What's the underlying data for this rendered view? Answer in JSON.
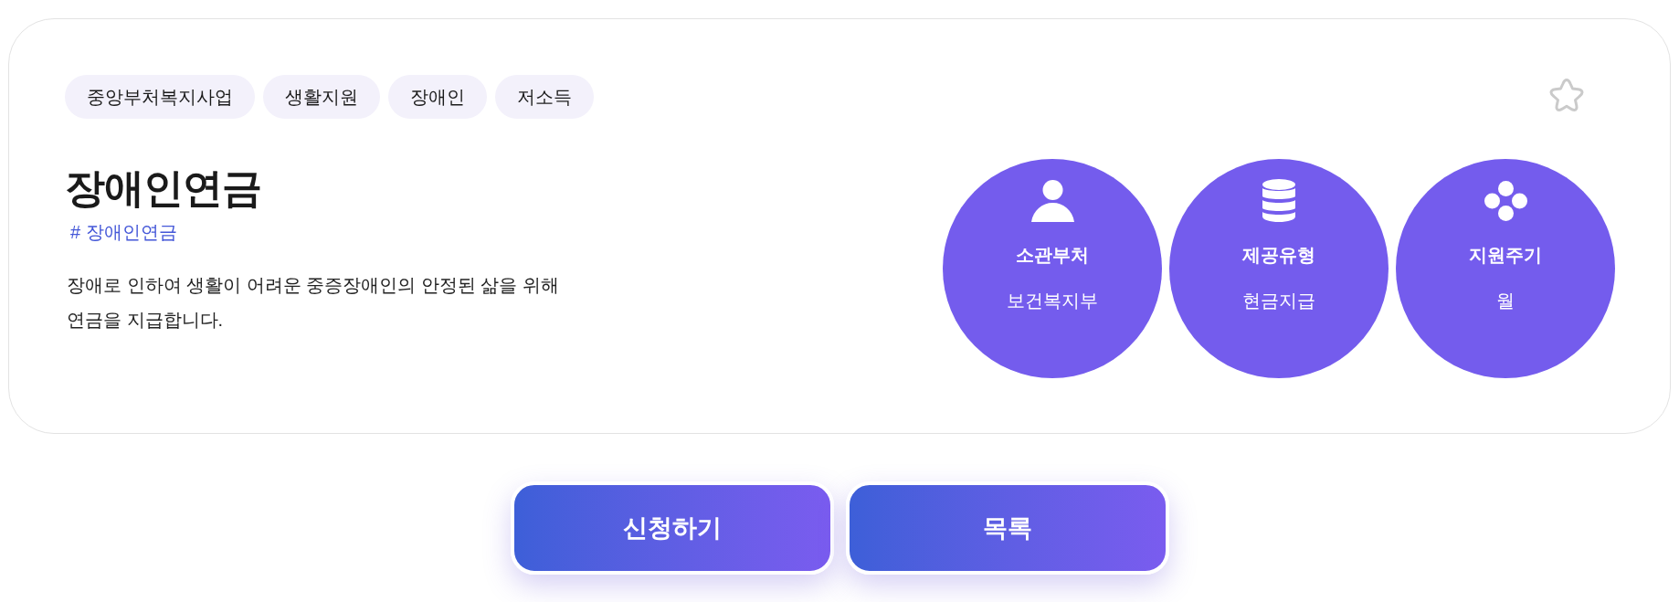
{
  "tags": [
    {
      "label": "중앙부처복지사업"
    },
    {
      "label": "생활지원"
    },
    {
      "label": "장애인"
    },
    {
      "label": "저소득"
    }
  ],
  "starred": false,
  "title": "장애인연금",
  "hashtag": "# 장애인연금",
  "description": "장애로 인하여 생활이 어려운 중증장애인의 안정된 삶을 위해 연금을 지급합니다.",
  "info": [
    {
      "kind": "user",
      "label": "소관부처",
      "value": "보건복지부"
    },
    {
      "kind": "database",
      "label": "제공유형",
      "value": "현금지급"
    },
    {
      "kind": "dots",
      "label": "지원주기",
      "value": "월"
    }
  ],
  "buttons": [
    {
      "label": "신청하기"
    },
    {
      "label": "목록"
    }
  ]
}
